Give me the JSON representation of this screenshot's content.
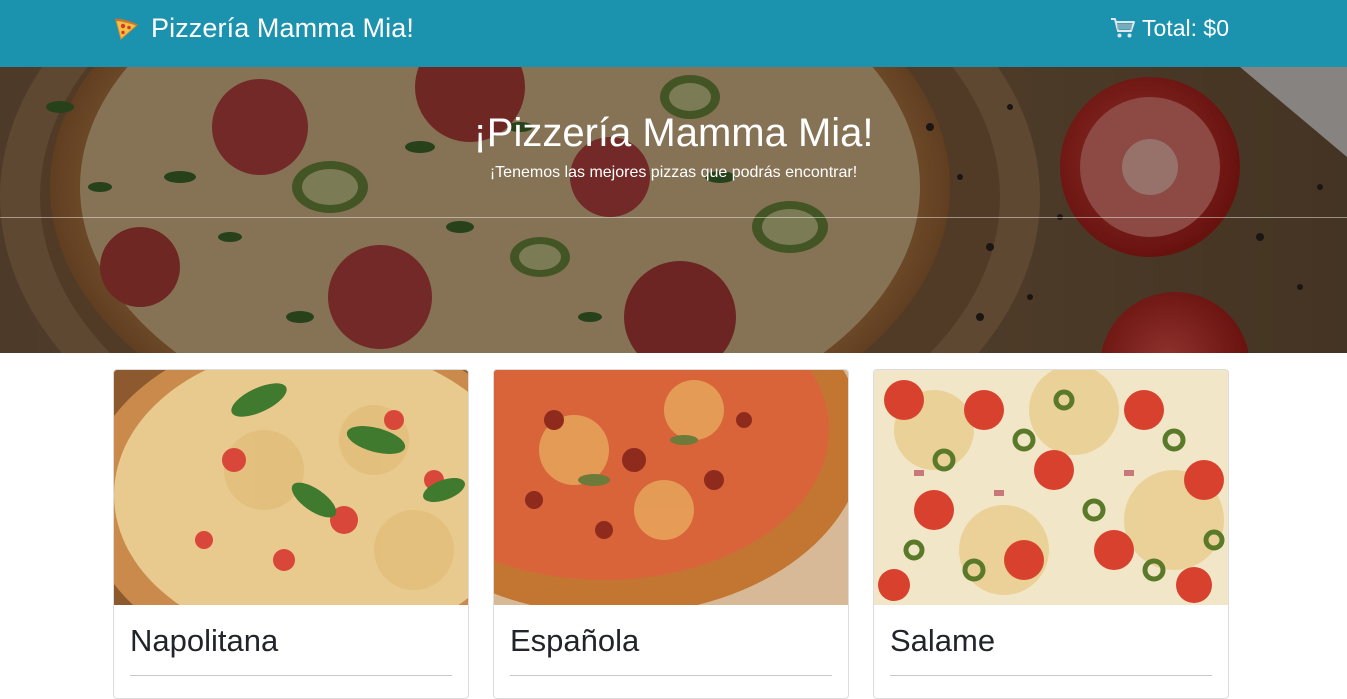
{
  "navbar": {
    "brand": "Pizzería Mamma Mia!",
    "brand_icon": "pizza-slice-icon",
    "cart_total": "Total: $0",
    "cart_icon": "shopping-cart-icon",
    "background_color": "#1b92ae"
  },
  "hero": {
    "title": "¡Pizzería Mamma Mia!",
    "subtitle": "¡Tenemos las mejores pizzas que podrás encontrar!"
  },
  "pizzas": [
    {
      "name": "Napolitana"
    },
    {
      "name": "Española"
    },
    {
      "name": "Salame"
    }
  ]
}
